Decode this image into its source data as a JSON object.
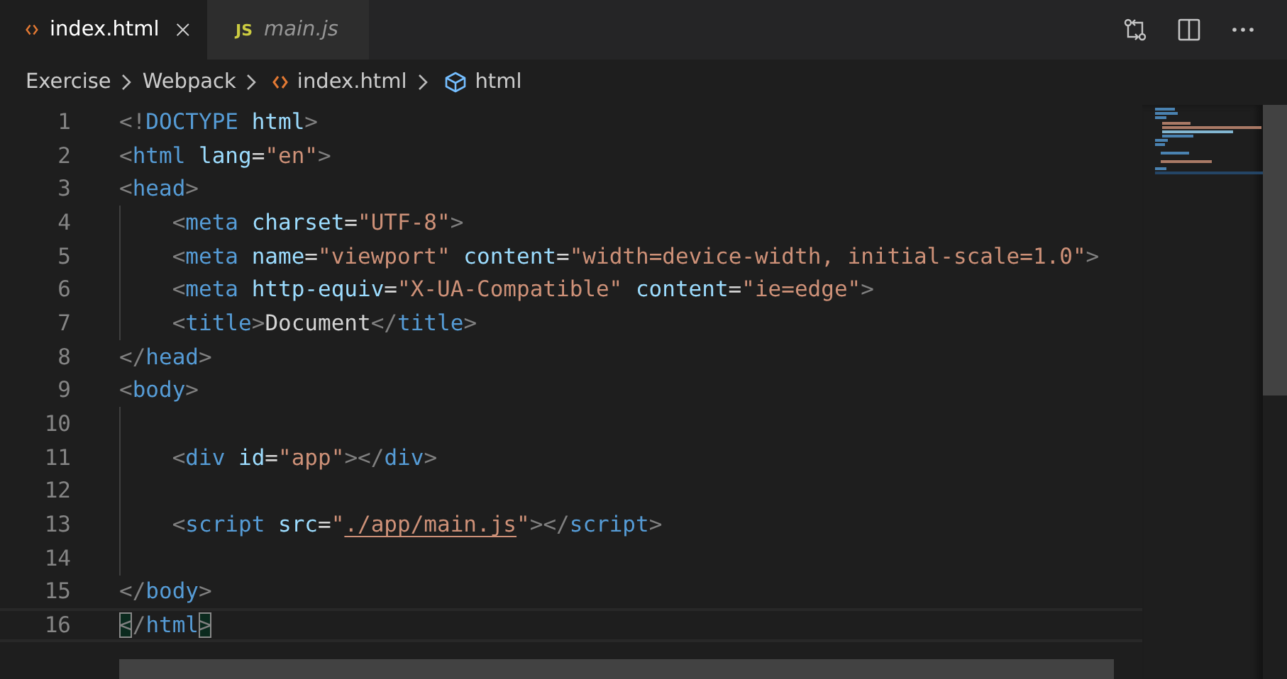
{
  "tabs": [
    {
      "label": "index.html",
      "kind": "html",
      "selected": true,
      "preview": false
    },
    {
      "label": "main.js",
      "kind": "js",
      "badge": "JS",
      "selected": false,
      "preview": true
    }
  ],
  "breadcrumbs": [
    {
      "label": "Exercise",
      "kind": "folder"
    },
    {
      "label": "Webpack",
      "kind": "folder"
    },
    {
      "label": "index.html",
      "kind": "html"
    },
    {
      "label": "html",
      "kind": "element"
    }
  ],
  "lines": [
    {
      "number": "1",
      "guide": false,
      "current": false,
      "tokens": [
        {
          "kind": "punct",
          "text": "<!"
        },
        {
          "kind": "tag",
          "text": "DOCTYPE"
        },
        {
          "kind": "attr",
          "text": " html"
        },
        {
          "kind": "punct",
          "text": ">"
        }
      ]
    },
    {
      "number": "2",
      "guide": false,
      "current": false,
      "tokens": [
        {
          "kind": "punct",
          "text": "<"
        },
        {
          "kind": "tag",
          "text": "html"
        },
        {
          "kind": "attr",
          "text": " lang"
        },
        {
          "kind": "text",
          "text": "="
        },
        {
          "kind": "str",
          "text": "\"en\""
        },
        {
          "kind": "punct",
          "text": ">"
        }
      ]
    },
    {
      "number": "3",
      "guide": false,
      "current": false,
      "tokens": [
        {
          "kind": "punct",
          "text": "<"
        },
        {
          "kind": "tag",
          "text": "head"
        },
        {
          "kind": "punct",
          "text": ">"
        }
      ]
    },
    {
      "number": "4",
      "guide": true,
      "current": false,
      "tokens": [
        {
          "kind": "punct",
          "text": "    <"
        },
        {
          "kind": "tag",
          "text": "meta"
        },
        {
          "kind": "attr",
          "text": " charset"
        },
        {
          "kind": "text",
          "text": "="
        },
        {
          "kind": "str",
          "text": "\"UTF-8\""
        },
        {
          "kind": "punct",
          "text": ">"
        }
      ]
    },
    {
      "number": "5",
      "guide": true,
      "current": false,
      "tokens": [
        {
          "kind": "punct",
          "text": "    <"
        },
        {
          "kind": "tag",
          "text": "meta"
        },
        {
          "kind": "attr",
          "text": " name"
        },
        {
          "kind": "text",
          "text": "="
        },
        {
          "kind": "str",
          "text": "\"viewport\""
        },
        {
          "kind": "attr",
          "text": " content"
        },
        {
          "kind": "text",
          "text": "="
        },
        {
          "kind": "str",
          "text": "\"width=device-width, initial-scale=1.0\""
        },
        {
          "kind": "punct",
          "text": ">"
        }
      ]
    },
    {
      "number": "6",
      "guide": true,
      "current": false,
      "tokens": [
        {
          "kind": "punct",
          "text": "    <"
        },
        {
          "kind": "tag",
          "text": "meta"
        },
        {
          "kind": "attr",
          "text": " http-equiv"
        },
        {
          "kind": "text",
          "text": "="
        },
        {
          "kind": "str",
          "text": "\"X-UA-Compatible\""
        },
        {
          "kind": "attr",
          "text": " content"
        },
        {
          "kind": "text",
          "text": "="
        },
        {
          "kind": "str",
          "text": "\"ie=edge\""
        },
        {
          "kind": "punct",
          "text": ">"
        }
      ]
    },
    {
      "number": "7",
      "guide": true,
      "current": false,
      "tokens": [
        {
          "kind": "punct",
          "text": "    <"
        },
        {
          "kind": "tag",
          "text": "title"
        },
        {
          "kind": "punct",
          "text": ">"
        },
        {
          "kind": "text",
          "text": "Document"
        },
        {
          "kind": "punct",
          "text": "</"
        },
        {
          "kind": "tag",
          "text": "title"
        },
        {
          "kind": "punct",
          "text": ">"
        }
      ]
    },
    {
      "number": "8",
      "guide": false,
      "current": false,
      "tokens": [
        {
          "kind": "punct",
          "text": "</"
        },
        {
          "kind": "tag",
          "text": "head"
        },
        {
          "kind": "punct",
          "text": ">"
        }
      ]
    },
    {
      "number": "9",
      "guide": false,
      "current": false,
      "tokens": [
        {
          "kind": "punct",
          "text": "<"
        },
        {
          "kind": "tag",
          "text": "body"
        },
        {
          "kind": "punct",
          "text": ">"
        }
      ]
    },
    {
      "number": "10",
      "guide": true,
      "current": false
    },
    {
      "number": "11",
      "guide": true,
      "current": false,
      "tokens": [
        {
          "kind": "punct",
          "text": "    <"
        },
        {
          "kind": "tag",
          "text": "div"
        },
        {
          "kind": "attr",
          "text": " id"
        },
        {
          "kind": "text",
          "text": "="
        },
        {
          "kind": "str",
          "text": "\"app\""
        },
        {
          "kind": "punct",
          "text": "></"
        },
        {
          "kind": "tag",
          "text": "div"
        },
        {
          "kind": "punct",
          "text": ">"
        }
      ]
    },
    {
      "number": "12",
      "guide": true,
      "current": false
    },
    {
      "number": "13",
      "guide": true,
      "current": false,
      "tokens": [
        {
          "kind": "punct",
          "text": "    <"
        },
        {
          "kind": "tag",
          "text": "script"
        },
        {
          "kind": "attr",
          "text": " src"
        },
        {
          "kind": "text",
          "text": "="
        },
        {
          "kind": "str",
          "text": "\""
        },
        {
          "kind": "link",
          "text": "./app/main.js"
        },
        {
          "kind": "str",
          "text": "\""
        },
        {
          "kind": "punct",
          "text": "></"
        },
        {
          "kind": "tag",
          "text": "script"
        },
        {
          "kind": "punct",
          "text": ">"
        }
      ]
    },
    {
      "number": "14",
      "guide": true,
      "current": false
    },
    {
      "number": "15",
      "guide": false,
      "current": false,
      "tokens": [
        {
          "kind": "punct",
          "text": "</"
        },
        {
          "kind": "tag",
          "text": "body"
        },
        {
          "kind": "punct",
          "text": ">"
        }
      ]
    },
    {
      "number": "16",
      "guide": false,
      "current": true,
      "tokens": [
        {
          "kind": "match",
          "text": "<"
        },
        {
          "kind": "punct",
          "text": "/"
        },
        {
          "kind": "tag",
          "text": "html"
        },
        {
          "kind": "match",
          "text": ">"
        }
      ]
    }
  ]
}
